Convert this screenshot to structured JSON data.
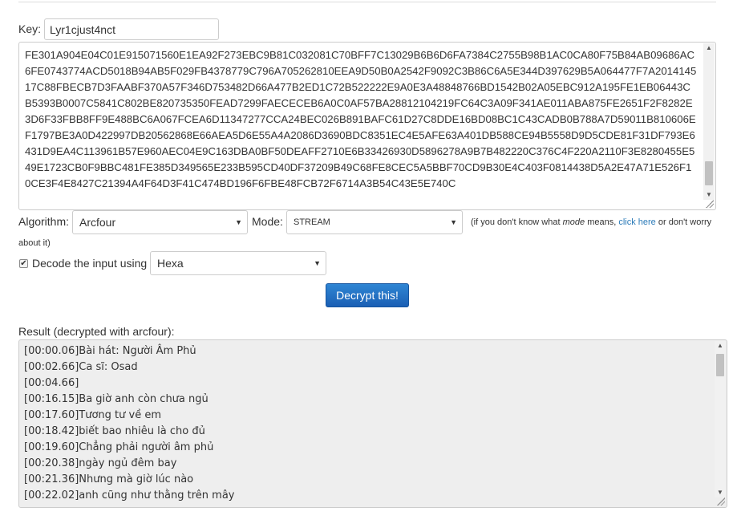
{
  "key": {
    "label": "Key:",
    "value": "Lyr1cjust4nct"
  },
  "input": {
    "text": "FE301A904E04C01E915071560E1EA92F273EBC9B81C032081C70BFF7C13029B6B6D6FA7384C2755B98B1AC0CA80F75B84AB09686AC6FE0743774ACD5018B94AB5F029FB4378779C796A705262810EEA9D50B0A2542F9092C3B86C6A5E344D397629B5A064477F7A201414517C88FBECB7D3FAABF370A57F346D753482D66A477B2ED1C72B522222E9A0E3A48848766BD1542B02A05EBC912A195FE1EB06443CB5393B0007C5841C802BE820735350FEAD7299FAECECEB6A0C0AF57BA28812104219FC64C3A09F341AE011ABA875FE2651F2F8282E3D6F33FBB8FF9E488BC6A067FCEA6D11347277CCA24BEC026B891BAFC61D27C8DDE16BD08BC1C43CADB0B788A7D59011B810606EF1797BE3A0D422997DB20562868E66AEA5D6E55A4A2086D3690BDC8351EC4E5AFE63A401DB588CE94B5558D9D5CDE81F31DF793E6431D9EA4C113961B57E960AEC04E9C163DBA0BF50DEAFF2710E6B33426930D5896278A9B7B482220C376C4F220A2110F3E8280455E549E1723CB0F9BBC481FE385D349565E233B595CD40DF37209B49C68FE8CEC5A5BBF70CD9B30E4C403F0814438D5A2E47A71E526F10CE3F4E8427C21394A4F64D3F41C474BD196F6FBE48FCB72F6714A3B54C43E5E740C"
  },
  "algorithm": {
    "label": "Algorithm:",
    "selected": "Arcfour"
  },
  "mode": {
    "label": "Mode:",
    "selected": "STREAM",
    "hint_before": "(if you don't know what",
    "hint_mode_word": "mode",
    "hint_middle": "means,",
    "hint_link": "click here",
    "hint_after": "or don't worry",
    "hint_wrap": "about it)"
  },
  "decode": {
    "label": "Decode the input using",
    "checked": true,
    "selected": "Hexa"
  },
  "decrypt_button": {
    "label": "Decrypt this!"
  },
  "result": {
    "label": "Result (decrypted with arcfour):",
    "lines": [
      "[00:00.06]Bài hát: Người Âm Phủ",
      "[00:02.66]Ca sĩ: Osad",
      "[00:04.66]",
      "[00:16.15]Ba giờ anh còn chưa ngủ",
      "[00:17.60]Tương tư về em",
      "[00:18.42]biết bao nhiêu là cho đủ",
      "[00:19.60]Chẳng phải người âm phủ",
      "[00:20.38]ngày ngủ đêm bay",
      "[00:21.36]Nhưng mà giờ lúc nào",
      "[00:22.02]anh cũng như thằng trên mây"
    ]
  },
  "colors": {
    "button": "#1a5fb4",
    "link": "#2a7ab8",
    "result_bg": "#eeeeee"
  }
}
